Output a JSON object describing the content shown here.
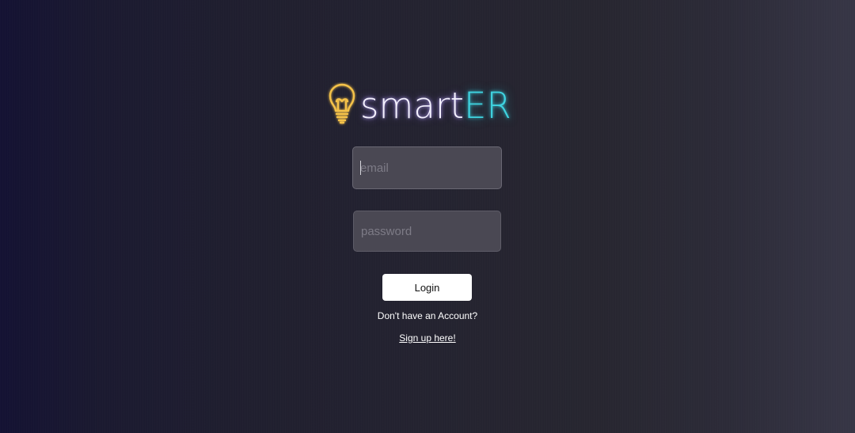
{
  "logo": {
    "icon": "lightbulb-icon",
    "wordmark_part1": "smart",
    "wordmark_part2": "ER",
    "colors": {
      "bulb": "#f5c24a",
      "part1": "#f4f1ff",
      "part2": "#3fd3e0"
    }
  },
  "form": {
    "email": {
      "placeholder": "email",
      "value": ""
    },
    "password": {
      "placeholder": "password",
      "value": ""
    },
    "login_label": "Login"
  },
  "signup": {
    "prompt": "Don't have an Account?",
    "link_label": "Sign up here!"
  },
  "colors": {
    "background_left": "#141233",
    "background_right": "#373646",
    "field_bg": "#4a4853",
    "button_bg": "#ffffff"
  }
}
